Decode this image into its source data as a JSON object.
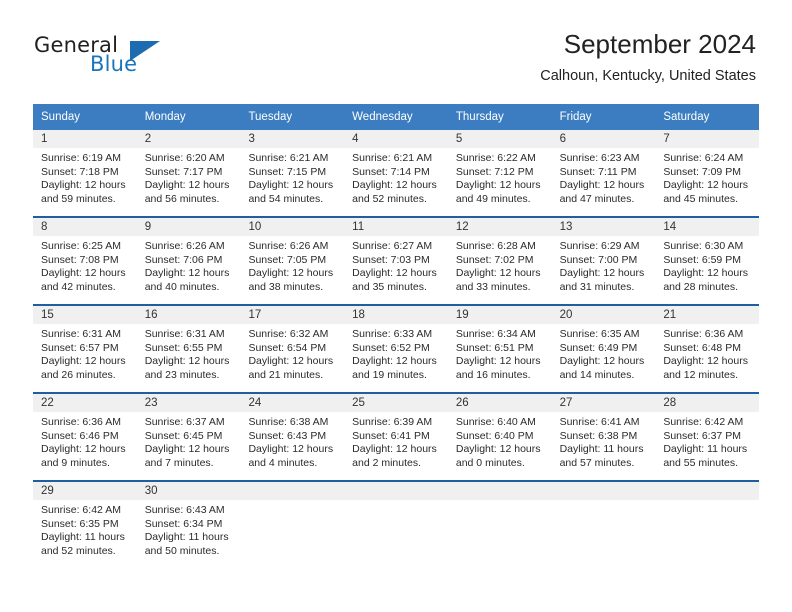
{
  "brand": {
    "name_part1": "General",
    "name_part2": "Blue",
    "accent_color": "#1b75bb",
    "triangle_color": "#1b6cb0"
  },
  "header": {
    "title": "September 2024",
    "subtitle": "Calhoun, Kentucky, United States"
  },
  "theme": {
    "header_row_bg": "#3b7dc0",
    "week_divider": "#1f5fa0",
    "day_band_bg": "#f0f0f0",
    "text_color": "#222222"
  },
  "weekdays": [
    "Sunday",
    "Monday",
    "Tuesday",
    "Wednesday",
    "Thursday",
    "Friday",
    "Saturday"
  ],
  "weeks": [
    [
      {
        "day": "1",
        "sunrise": "Sunrise: 6:19 AM",
        "sunset": "Sunset: 7:18 PM",
        "daylight1": "Daylight: 12 hours",
        "daylight2": "and 59 minutes."
      },
      {
        "day": "2",
        "sunrise": "Sunrise: 6:20 AM",
        "sunset": "Sunset: 7:17 PM",
        "daylight1": "Daylight: 12 hours",
        "daylight2": "and 56 minutes."
      },
      {
        "day": "3",
        "sunrise": "Sunrise: 6:21 AM",
        "sunset": "Sunset: 7:15 PM",
        "daylight1": "Daylight: 12 hours",
        "daylight2": "and 54 minutes."
      },
      {
        "day": "4",
        "sunrise": "Sunrise: 6:21 AM",
        "sunset": "Sunset: 7:14 PM",
        "daylight1": "Daylight: 12 hours",
        "daylight2": "and 52 minutes."
      },
      {
        "day": "5",
        "sunrise": "Sunrise: 6:22 AM",
        "sunset": "Sunset: 7:12 PM",
        "daylight1": "Daylight: 12 hours",
        "daylight2": "and 49 minutes."
      },
      {
        "day": "6",
        "sunrise": "Sunrise: 6:23 AM",
        "sunset": "Sunset: 7:11 PM",
        "daylight1": "Daylight: 12 hours",
        "daylight2": "and 47 minutes."
      },
      {
        "day": "7",
        "sunrise": "Sunrise: 6:24 AM",
        "sunset": "Sunset: 7:09 PM",
        "daylight1": "Daylight: 12 hours",
        "daylight2": "and 45 minutes."
      }
    ],
    [
      {
        "day": "8",
        "sunrise": "Sunrise: 6:25 AM",
        "sunset": "Sunset: 7:08 PM",
        "daylight1": "Daylight: 12 hours",
        "daylight2": "and 42 minutes."
      },
      {
        "day": "9",
        "sunrise": "Sunrise: 6:26 AM",
        "sunset": "Sunset: 7:06 PM",
        "daylight1": "Daylight: 12 hours",
        "daylight2": "and 40 minutes."
      },
      {
        "day": "10",
        "sunrise": "Sunrise: 6:26 AM",
        "sunset": "Sunset: 7:05 PM",
        "daylight1": "Daylight: 12 hours",
        "daylight2": "and 38 minutes."
      },
      {
        "day": "11",
        "sunrise": "Sunrise: 6:27 AM",
        "sunset": "Sunset: 7:03 PM",
        "daylight1": "Daylight: 12 hours",
        "daylight2": "and 35 minutes."
      },
      {
        "day": "12",
        "sunrise": "Sunrise: 6:28 AM",
        "sunset": "Sunset: 7:02 PM",
        "daylight1": "Daylight: 12 hours",
        "daylight2": "and 33 minutes."
      },
      {
        "day": "13",
        "sunrise": "Sunrise: 6:29 AM",
        "sunset": "Sunset: 7:00 PM",
        "daylight1": "Daylight: 12 hours",
        "daylight2": "and 31 minutes."
      },
      {
        "day": "14",
        "sunrise": "Sunrise: 6:30 AM",
        "sunset": "Sunset: 6:59 PM",
        "daylight1": "Daylight: 12 hours",
        "daylight2": "and 28 minutes."
      }
    ],
    [
      {
        "day": "15",
        "sunrise": "Sunrise: 6:31 AM",
        "sunset": "Sunset: 6:57 PM",
        "daylight1": "Daylight: 12 hours",
        "daylight2": "and 26 minutes."
      },
      {
        "day": "16",
        "sunrise": "Sunrise: 6:31 AM",
        "sunset": "Sunset: 6:55 PM",
        "daylight1": "Daylight: 12 hours",
        "daylight2": "and 23 minutes."
      },
      {
        "day": "17",
        "sunrise": "Sunrise: 6:32 AM",
        "sunset": "Sunset: 6:54 PM",
        "daylight1": "Daylight: 12 hours",
        "daylight2": "and 21 minutes."
      },
      {
        "day": "18",
        "sunrise": "Sunrise: 6:33 AM",
        "sunset": "Sunset: 6:52 PM",
        "daylight1": "Daylight: 12 hours",
        "daylight2": "and 19 minutes."
      },
      {
        "day": "19",
        "sunrise": "Sunrise: 6:34 AM",
        "sunset": "Sunset: 6:51 PM",
        "daylight1": "Daylight: 12 hours",
        "daylight2": "and 16 minutes."
      },
      {
        "day": "20",
        "sunrise": "Sunrise: 6:35 AM",
        "sunset": "Sunset: 6:49 PM",
        "daylight1": "Daylight: 12 hours",
        "daylight2": "and 14 minutes."
      },
      {
        "day": "21",
        "sunrise": "Sunrise: 6:36 AM",
        "sunset": "Sunset: 6:48 PM",
        "daylight1": "Daylight: 12 hours",
        "daylight2": "and 12 minutes."
      }
    ],
    [
      {
        "day": "22",
        "sunrise": "Sunrise: 6:36 AM",
        "sunset": "Sunset: 6:46 PM",
        "daylight1": "Daylight: 12 hours",
        "daylight2": "and 9 minutes."
      },
      {
        "day": "23",
        "sunrise": "Sunrise: 6:37 AM",
        "sunset": "Sunset: 6:45 PM",
        "daylight1": "Daylight: 12 hours",
        "daylight2": "and 7 minutes."
      },
      {
        "day": "24",
        "sunrise": "Sunrise: 6:38 AM",
        "sunset": "Sunset: 6:43 PM",
        "daylight1": "Daylight: 12 hours",
        "daylight2": "and 4 minutes."
      },
      {
        "day": "25",
        "sunrise": "Sunrise: 6:39 AM",
        "sunset": "Sunset: 6:41 PM",
        "daylight1": "Daylight: 12 hours",
        "daylight2": "and 2 minutes."
      },
      {
        "day": "26",
        "sunrise": "Sunrise: 6:40 AM",
        "sunset": "Sunset: 6:40 PM",
        "daylight1": "Daylight: 12 hours",
        "daylight2": "and 0 minutes."
      },
      {
        "day": "27",
        "sunrise": "Sunrise: 6:41 AM",
        "sunset": "Sunset: 6:38 PM",
        "daylight1": "Daylight: 11 hours",
        "daylight2": "and 57 minutes."
      },
      {
        "day": "28",
        "sunrise": "Sunrise: 6:42 AM",
        "sunset": "Sunset: 6:37 PM",
        "daylight1": "Daylight: 11 hours",
        "daylight2": "and 55 minutes."
      }
    ],
    [
      {
        "day": "29",
        "sunrise": "Sunrise: 6:42 AM",
        "sunset": "Sunset: 6:35 PM",
        "daylight1": "Daylight: 11 hours",
        "daylight2": "and 52 minutes."
      },
      {
        "day": "30",
        "sunrise": "Sunrise: 6:43 AM",
        "sunset": "Sunset: 6:34 PM",
        "daylight1": "Daylight: 11 hours",
        "daylight2": "and 50 minutes."
      },
      {
        "day": "",
        "sunrise": "",
        "sunset": "",
        "daylight1": "",
        "daylight2": ""
      },
      {
        "day": "",
        "sunrise": "",
        "sunset": "",
        "daylight1": "",
        "daylight2": ""
      },
      {
        "day": "",
        "sunrise": "",
        "sunset": "",
        "daylight1": "",
        "daylight2": ""
      },
      {
        "day": "",
        "sunrise": "",
        "sunset": "",
        "daylight1": "",
        "daylight2": ""
      },
      {
        "day": "",
        "sunrise": "",
        "sunset": "",
        "daylight1": "",
        "daylight2": ""
      }
    ]
  ]
}
